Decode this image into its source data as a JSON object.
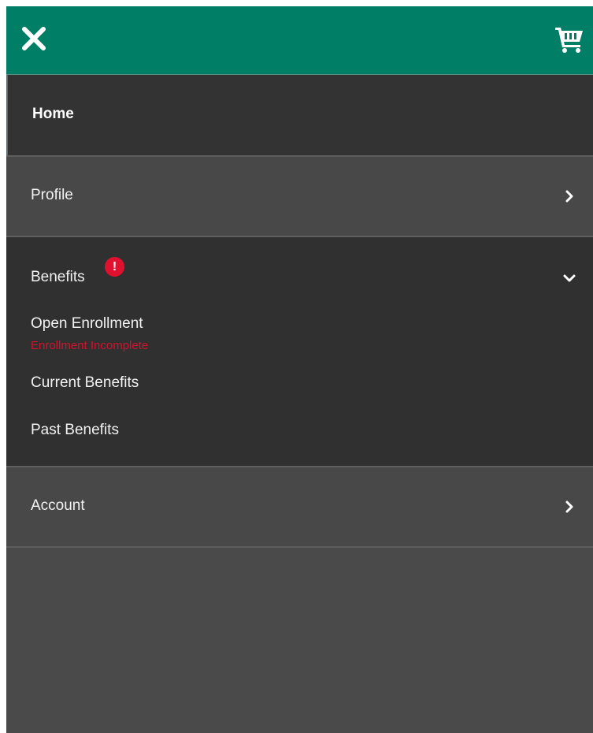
{
  "header": {
    "close_icon": "close-icon",
    "cart_icon": "shopping-cart-icon",
    "bar_color": "#007f66"
  },
  "menu": {
    "home": {
      "label": "Home"
    },
    "profile": {
      "label": "Profile",
      "icon": "chevron-right-icon"
    },
    "benefits": {
      "label": "Benefits",
      "alert": "!",
      "alert_color": "#e0112e",
      "icon": "chevron-down-icon",
      "expanded": true,
      "items": [
        {
          "label": "Open Enrollment",
          "status": "Enrollment Incomplete"
        },
        {
          "label": "Current Benefits"
        },
        {
          "label": "Past Benefits"
        }
      ]
    },
    "account": {
      "label": "Account",
      "icon": "chevron-right-icon"
    }
  }
}
